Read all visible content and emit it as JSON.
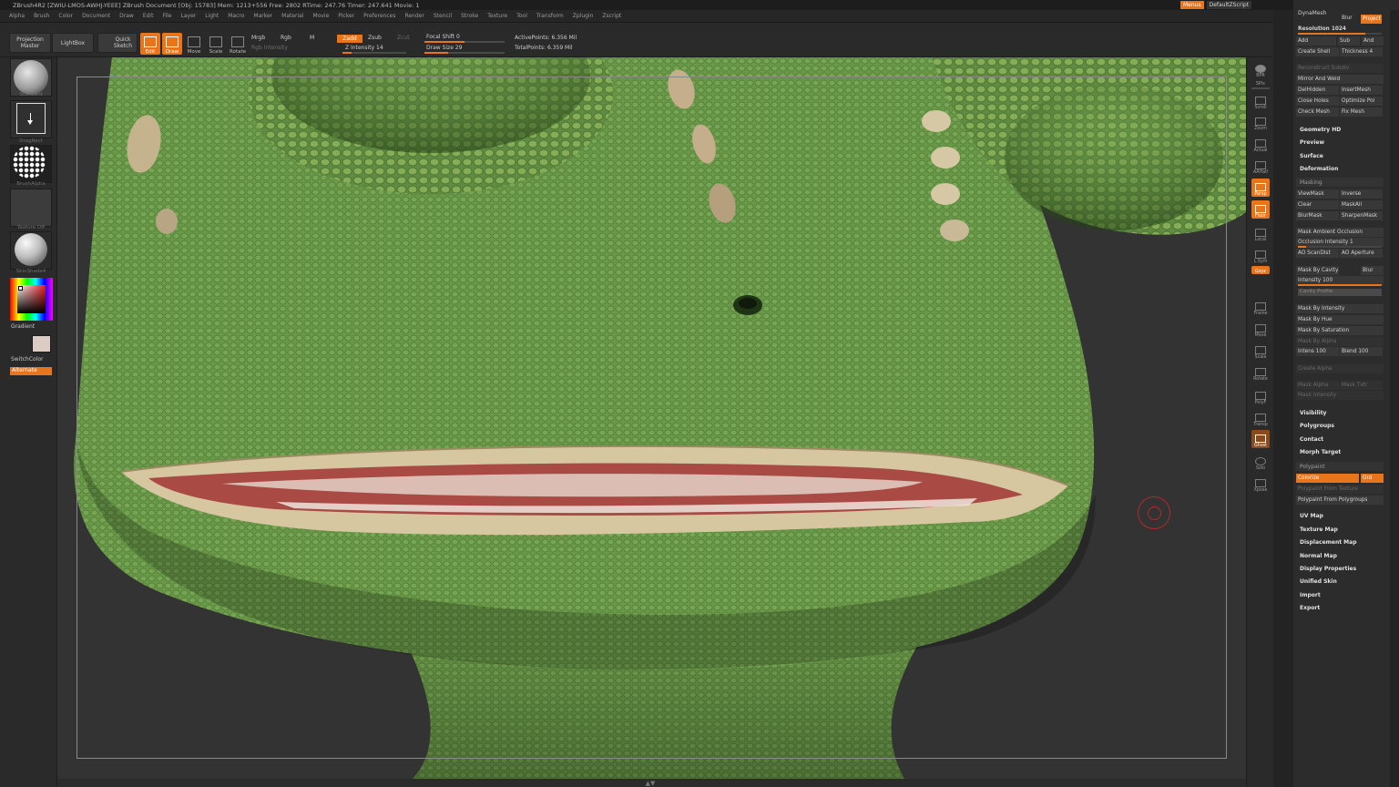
{
  "titlebar": {
    "text": "ZBrush4R2 [ZWIU-LMOS-AWHJ-YEEE]    ZBrush Document    [Obj: 15783] Mem: 1213+556 Free: 2802 RTime: 247.76 Timer: 247.641 Movie: 1",
    "menus_label": "Menus",
    "script_label": "DefaultZScript"
  },
  "menubar": [
    "Alpha",
    "Brush",
    "Color",
    "Document",
    "Draw",
    "Edit",
    "File",
    "Layer",
    "Light",
    "Macro",
    "Marker",
    "Material",
    "Movie",
    "Picker",
    "Preferences",
    "Render",
    "Stencil",
    "Stroke",
    "Texture",
    "Tool",
    "Transform",
    "Zplugin",
    "Zscript"
  ],
  "toolbar": {
    "projection_master": "Projection Master",
    "lightbox": "LightBox",
    "quick_sketch": "Quick Sketch",
    "edit": "Edit",
    "draw": "Draw",
    "move": "Move",
    "scale": "Scale",
    "rotate": "Rotate",
    "mrgb": "Mrgb",
    "rgb": "Rgb",
    "m": "M",
    "rgb_intensity": "Rgb Intensity",
    "zadd": "Zadd",
    "zsub": "Zsub",
    "zcut": "Zcut",
    "z_intensity": "Z Intensity 14",
    "focal_shift": "Focal Shift 0",
    "draw_size": "Draw Size 29",
    "active_points": "ActivePoints: 6.356 Mil",
    "total_points": "TotalPoints: 6.359 Mil"
  },
  "left_shelf": {
    "brush_label": "Standard",
    "stroke_label": "DragRect",
    "alpha_label": "BrushAlpha",
    "texture_label": "Texture Off",
    "material_label": "SkinShade4",
    "gradient_label": "Gradient",
    "switch_color": "SwitchColor",
    "alternate": "Alternate"
  },
  "right_shelf": [
    "BPR",
    "SPix",
    "Scroll",
    "Zoom",
    "Actual",
    "AAHalf",
    "Persp",
    "Floor",
    "Local",
    "L.Sym",
    "Gxyz",
    "Frame",
    "Move",
    "Scale",
    "Rotate",
    "PolyF",
    "Transp",
    "Ghost",
    "Solo",
    "Xpose"
  ],
  "right_panel": {
    "dynamesh": "DynaMesh",
    "blur": "Blur",
    "project": "Project",
    "resolution": "Resolution 1024",
    "add": "Add",
    "sub": "Sub",
    "and": "And",
    "create_shell": "Create Shell",
    "thickness": "Thickness 4",
    "reconstruct_subdiv": "Reconstruct Subdiv",
    "mirror_and_weld": "Mirror And Weld",
    "delhidden": "DelHidden",
    "insertmesh": "InsertMesh",
    "close_holes": "Close Holes",
    "optimize_points": "Optimize Poi",
    "check_mesh": "Check Mesh",
    "fix_mesh": "Fix Mesh",
    "geometry_hd": "Geometry HD",
    "preview": "Preview",
    "surface": "Surface",
    "deformation": "Deformation",
    "masking": "Masking",
    "viewmask": "ViewMask",
    "inverse": "Inverse",
    "clear": "Clear",
    "maskall": "MaskAll",
    "blurmask": "BlurMask",
    "sharpenmask": "SharpenMask",
    "mask_ambient_occlusion": "Mask Ambient Occlusion",
    "occlusion_intensity": "Occlusion Intensity 1",
    "ao_scandist": "AO ScanDist",
    "ao_aperture": "AO Aperture",
    "mask_by_cavity": "Mask By Cavity",
    "cavity_blur": "Blur",
    "intensity_100": "Intensity 100",
    "cavity_profile": "Cavity Profile",
    "mask_by_intensity": "Mask By Intensity",
    "mask_by_hue": "Mask By Hue",
    "mask_by_saturation": "Mask By Saturation",
    "mask_by_alpha": "Mask By Alpha",
    "intens_100": "Intens 100",
    "blend_100": "Blend 100",
    "create_alpha": "Create Alpha",
    "mask_alpha": "Mask Alpha",
    "mask_tex": "Mask Txtr",
    "mask_intensity": "Mask Intensity",
    "visibility": "Visibility",
    "polygroups": "Polygroups",
    "contact": "Contact",
    "morph_target": "Morph Target",
    "polypaint": "Polypaint",
    "colorize": "Colorize",
    "grd": "Grd",
    "polypaint_from_texture": "Polypaint From Texture",
    "polypaint_from_polygroups": "Polypaint From Polygroups",
    "uv_map": "UV Map",
    "texture_map": "Texture Map",
    "displacement_map": "Displacement Map",
    "normal_map": "Normal Map",
    "display_properties": "Display Properties",
    "unified_skin": "Unified Skin",
    "import": "Import",
    "export": "Export"
  },
  "colors": {
    "accent": "#e8741c",
    "panel": "#2c2c2c",
    "canvas_bg": "#333333",
    "skin_green": "#6b9a4a",
    "lip": "#d8caa4",
    "mouth": "#b45a52"
  },
  "sliders": {
    "z_intensity": 0.14,
    "draw_size": 0.29,
    "focal_shift": 0.5,
    "resolution": 0.8,
    "occlusion_intensity": 0.1,
    "intensity_100": 1.0
  }
}
